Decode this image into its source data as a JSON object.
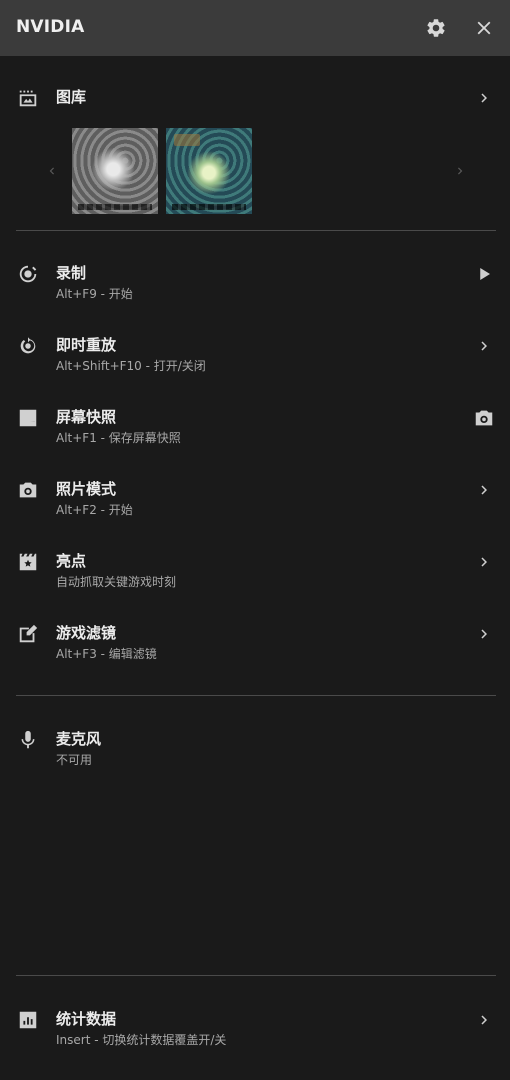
{
  "header": {
    "brand": "NVIDIA"
  },
  "gallery": {
    "title": "图库"
  },
  "features": [
    {
      "title": "录制",
      "subtitle": "Alt+F9 - 开始"
    },
    {
      "title": "即时重放",
      "subtitle": "Alt+Shift+F10 - 打开/关闭"
    },
    {
      "title": "屏幕快照",
      "subtitle": "Alt+F1 - 保存屏幕快照"
    },
    {
      "title": "照片模式",
      "subtitle": "Alt+F2 - 开始"
    },
    {
      "title": "亮点",
      "subtitle": "自动抓取关键游戏时刻"
    },
    {
      "title": "游戏滤镜",
      "subtitle": "Alt+F3 - 编辑滤镜"
    }
  ],
  "microphone": {
    "title": "麦克风",
    "subtitle": "不可用"
  },
  "stats": {
    "title": "统计数据",
    "subtitle": "Insert - 切换统计数据覆盖开/关"
  },
  "colors": {
    "background": "#1a1a1a",
    "header": "#3b3b3b",
    "divider": "#4a4a4a",
    "subtext": "#a8a8a8"
  }
}
